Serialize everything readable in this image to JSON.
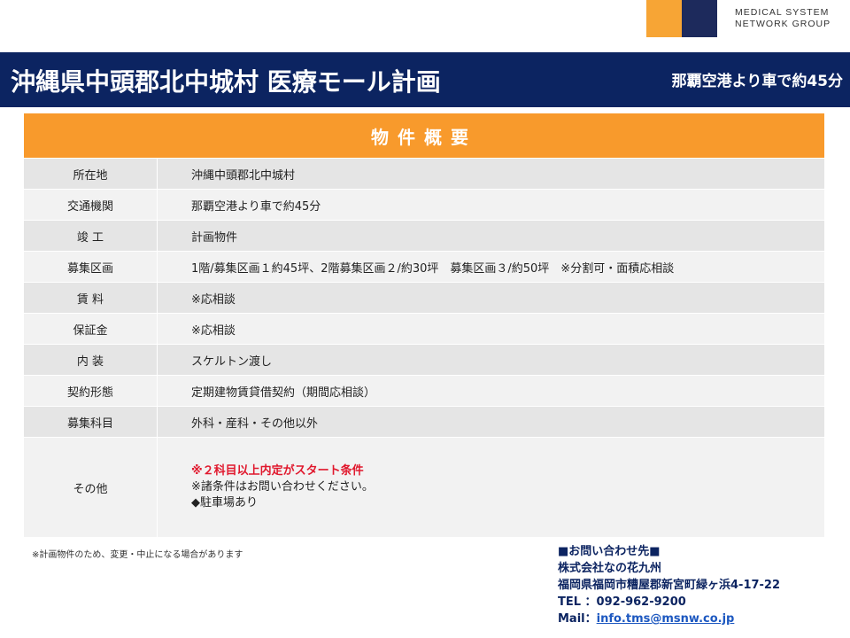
{
  "logo": {
    "line1": "MEDICAL SYSTEM",
    "line2": "NETWORK GROUP"
  },
  "banner": {
    "title": "沖縄県中頭郡北中城村 医療モール計画",
    "subtitle": "那覇空港より車で約45分"
  },
  "sheet": {
    "heading": "物件概要",
    "rows": [
      {
        "label": "所在地",
        "value": "沖縄中頭郡北中城村"
      },
      {
        "label": "交通機関",
        "value": "那覇空港より車で約45分"
      },
      {
        "label": "竣 工",
        "value": "計画物件"
      },
      {
        "label": "募集区画",
        "value": "1階/募集区画１約45坪、2階募集区画２/約30坪　募集区画３/約50坪　※分割可・面積応相談"
      },
      {
        "label": "賃 料",
        "value": "※応相談"
      },
      {
        "label": "保証金",
        "value": "※応相談"
      },
      {
        "label": "内 装",
        "value": "スケルトン渡し"
      },
      {
        "label": "契約形態",
        "value": "定期建物賃貸借契約（期間応相談）"
      },
      {
        "label": "募集科目",
        "value": "外科・産科・その他以外"
      },
      {
        "label": "その他",
        "line1": "※２科目以上内定がスタート条件",
        "line2": "※諸条件はお問い合わせください。",
        "line3": "◆駐車場あり"
      }
    ]
  },
  "note": "※計画物件のため、変更・中止になる場合があります",
  "contact": {
    "heading": "■お問い合わせ先■",
    "company": "株式会社なの花九州",
    "address": "福岡県福岡市糟屋郡新宮町緑ヶ浜4-17-22",
    "tel": "TEL ：092-962-9200",
    "mail_label": "Mail：",
    "mail": "info.tms@msnw.co.jp"
  },
  "colors": {
    "navy": "#0c2461",
    "orange": "#f89a2c",
    "red": "#e0182d",
    "row_gray": "#e5e5e5"
  }
}
